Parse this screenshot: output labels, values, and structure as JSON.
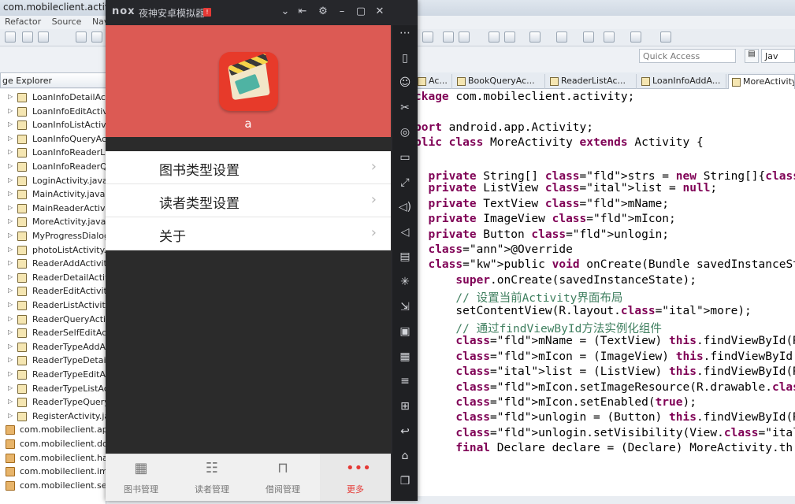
{
  "eclipse": {
    "window_title": "com.mobileclient.activity.Lo",
    "menu": [
      "Refactor",
      "Source",
      "Navi"
    ],
    "quick_access_placeholder": "Quick Access",
    "perspective": "Jav",
    "package_explorer_tab": "ge Explorer",
    "tree_items": [
      {
        "label": "LoanInfoDetailActi",
        "kind": "file"
      },
      {
        "label": "LoanInfoEditActivi",
        "kind": "file"
      },
      {
        "label": "LoanInfoListActivi",
        "kind": "file"
      },
      {
        "label": "LoanInfoQueryActi",
        "kind": "file"
      },
      {
        "label": "LoanInfoReaderLi",
        "kind": "file"
      },
      {
        "label": "LoanInfoReaderQ",
        "kind": "file"
      },
      {
        "label": "LoginActivity.java",
        "kind": "file"
      },
      {
        "label": "MainActivity.java",
        "kind": "file"
      },
      {
        "label": "MainReaderActivit",
        "kind": "file"
      },
      {
        "label": "MoreActivity.java",
        "kind": "file"
      },
      {
        "label": "MyProgressDialog",
        "kind": "file"
      },
      {
        "label": "photoListActivity.ja",
        "kind": "file"
      },
      {
        "label": "ReaderAddActivity",
        "kind": "file"
      },
      {
        "label": "ReaderDetailActivi",
        "kind": "file"
      },
      {
        "label": "ReaderEditActivity",
        "kind": "file"
      },
      {
        "label": "ReaderListActivity.",
        "kind": "file"
      },
      {
        "label": "ReaderQueryActivi",
        "kind": "file"
      },
      {
        "label": "ReaderSelfEditAct",
        "kind": "file"
      },
      {
        "label": "ReaderTypeAddAc",
        "kind": "file"
      },
      {
        "label": "ReaderTypeDetail",
        "kind": "file"
      },
      {
        "label": "ReaderTypeEditAc",
        "kind": "file"
      },
      {
        "label": "ReaderTypeListAct",
        "kind": "file"
      },
      {
        "label": "ReaderTypeQuery",
        "kind": "file"
      },
      {
        "label": "RegisterActivity.jav",
        "kind": "file"
      },
      {
        "label": "com.mobileclient.app",
        "kind": "package"
      },
      {
        "label": "com.mobileclient.dom",
        "kind": "package"
      },
      {
        "label": "com.mobileclient.han",
        "kind": "package"
      },
      {
        "label": "com.mobileclient.img",
        "kind": "package"
      },
      {
        "label": "com.mobileclient.ser",
        "kind": "package"
      }
    ],
    "editor_tabs": [
      "Ac...",
      "BookQueryAc...",
      "ReaderListAc...",
      "LoanInfoAddA...",
      "MoreActivity..."
    ],
    "code_lines": [
      "ckage com.mobileclient.activity;",
      "",
      "port android.app.Activity;",
      "blic class MoreActivity extends Activity {",
      "",
      "  private String[] strs = new String[]{\"图书类型设置\",\"读者",
      "  private ListView list = null;",
      "  private TextView mName;",
      "  private ImageView mIcon;",
      "  private Button unlogin;",
      "  @Override",
      "  public void onCreate(Bundle savedInstanceState) {",
      "      super.onCreate(savedInstanceState);",
      "      // 设置当前Activity界面布局",
      "      setContentView(R.layout.more);",
      "      // 通过findViewById方法实例化组件",
      "      mName = (TextView) this.findViewById(R.id.usernam",
      "      mIcon = (ImageView) this.findViewById(R.id.icon);",
      "      list = (ListView) this.findViewById(R.id.list);",
      "      mIcon.setImageResource(R.drawable.icon);",
      "      mIcon.setEnabled(true);",
      "      unlogin = (Button) this.findViewById(R.id.unlogi",
      "      unlogin.setVisibility(View.GONE);",
      "      final Declare declare = (Declare) MoreActivity.th"
    ]
  },
  "nox": {
    "logo": "nox",
    "title": "夜神安卓模拟器",
    "badge": "!",
    "controls": [
      "⌄",
      "⇤",
      "⚙",
      "–",
      "▢",
      "✕"
    ],
    "side_buttons": [
      "⋯",
      "▯",
      "☺",
      "✂",
      "◎",
      "▭",
      "⤢",
      "◁)",
      "◁",
      "▤",
      "✳",
      "⇲",
      "▣",
      "▦",
      "≡",
      "⊞",
      "↩",
      "⌂",
      "❐"
    ]
  },
  "app": {
    "user_name": "a",
    "menu_items": [
      "图书类型设置",
      "读者类型设置",
      "关于"
    ],
    "chevron": "›",
    "bottom_nav": [
      {
        "label": "图书管理",
        "icon": "book-icon",
        "glyph": "▦",
        "active": false
      },
      {
        "label": "读者管理",
        "icon": "reader-icon",
        "glyph": "☷",
        "active": false
      },
      {
        "label": "借阅管理",
        "icon": "borrow-icon",
        "glyph": "⊓",
        "active": false
      },
      {
        "label": "更多",
        "icon": "more-icon",
        "glyph": "•••",
        "active": true
      }
    ],
    "accent_color": "#dc5a54"
  }
}
